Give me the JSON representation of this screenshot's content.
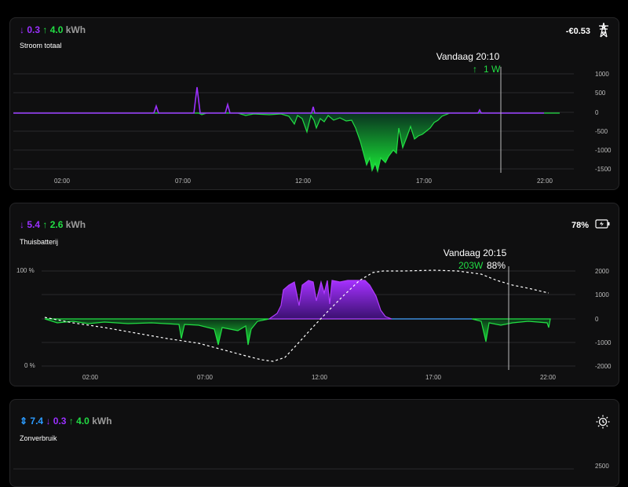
{
  "cards": {
    "grid": {
      "title_down": "0.3",
      "title_up": "4.0",
      "unit": "kWh",
      "subtitle": "Stroom totaal",
      "cost": "-€0.53",
      "icon": "power-tower-icon",
      "tooltip_time": "Vandaag 20:10",
      "tooltip_value": "1 W",
      "x_ticks": [
        "02:00",
        "07:00",
        "12:00",
        "17:00",
        "22:00"
      ],
      "y_ticks": [
        "1000",
        "500",
        "0",
        "-500",
        "-1000",
        "-1500"
      ]
    },
    "battery": {
      "title_down": "5.4",
      "title_up": "2.6",
      "unit": "kWh",
      "subtitle": "Thuisbatterij",
      "soc": "78%",
      "icon": "battery-charging-icon",
      "tooltip_time": "Vandaag 20:15",
      "tooltip_power": "203W",
      "tooltip_soc": "88%",
      "x_ticks": [
        "02:00",
        "07:00",
        "12:00",
        "17:00",
        "22:00"
      ],
      "y_ticks_right": [
        "2000",
        "1000",
        "0",
        "-1000",
        "-2000"
      ],
      "y_ticks_left": [
        "100 %",
        "0 %"
      ]
    },
    "solar": {
      "title_total": "7.4",
      "title_down": "0.3",
      "title_up": "4.0",
      "unit": "kWh",
      "subtitle": "Zonverbruik",
      "icon": "sun-clock-icon",
      "y_tick_top": "2500"
    }
  },
  "colors": {
    "purple": "#9b30ff",
    "green": "#22dd44",
    "blue": "#2b9bff",
    "card_bg": "#0f0f10"
  }
}
